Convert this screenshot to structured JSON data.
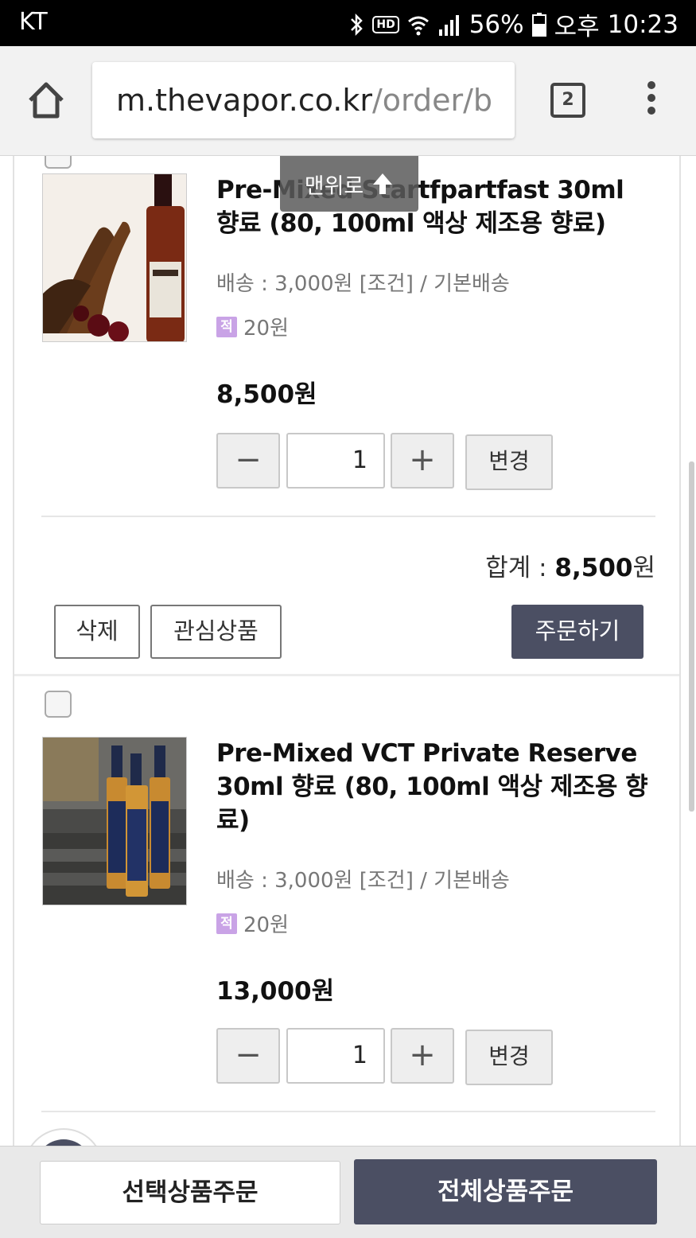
{
  "status_bar": {
    "carrier": "KT",
    "battery_percent": "56%",
    "time_period": "오후",
    "time": "10:23"
  },
  "browser": {
    "url_domain": "m.thevapor.co.kr",
    "url_path": "/order/b",
    "tab_count": "2"
  },
  "scroll_top": {
    "label": "맨위로"
  },
  "items": [
    {
      "name": "Pre-Mixed Startfpartfast 30ml 향료 (80, 100ml 액상 제조용 향료)",
      "shipping": "배송 : 3,000원 [조건] / 기본배송",
      "points_badge": "적",
      "points": "20원",
      "price": "8,500원",
      "quantity": "1",
      "change_label": "변경",
      "total_label": "합계 : ",
      "total_value": "8,500",
      "total_unit": "원",
      "delete_label": "삭제",
      "wishlist_label": "관심상품",
      "order_label": "주문하기"
    },
    {
      "name": "Pre-Mixed VCT Private Reserve 30ml 향료 (80, 100ml 액상 제조용 향료)",
      "shipping": "배송 : 3,000원 [조건] / 기본배송",
      "points_badge": "적",
      "points": "20원",
      "price": "13,000원",
      "quantity": "1",
      "change_label": "변경"
    }
  ],
  "bottom_bar": {
    "order_selected": "선택상품주문",
    "order_all": "전체상품주문"
  },
  "colors": {
    "dark_button": "#4b4f63",
    "points_badge": "#c9a3e6"
  }
}
